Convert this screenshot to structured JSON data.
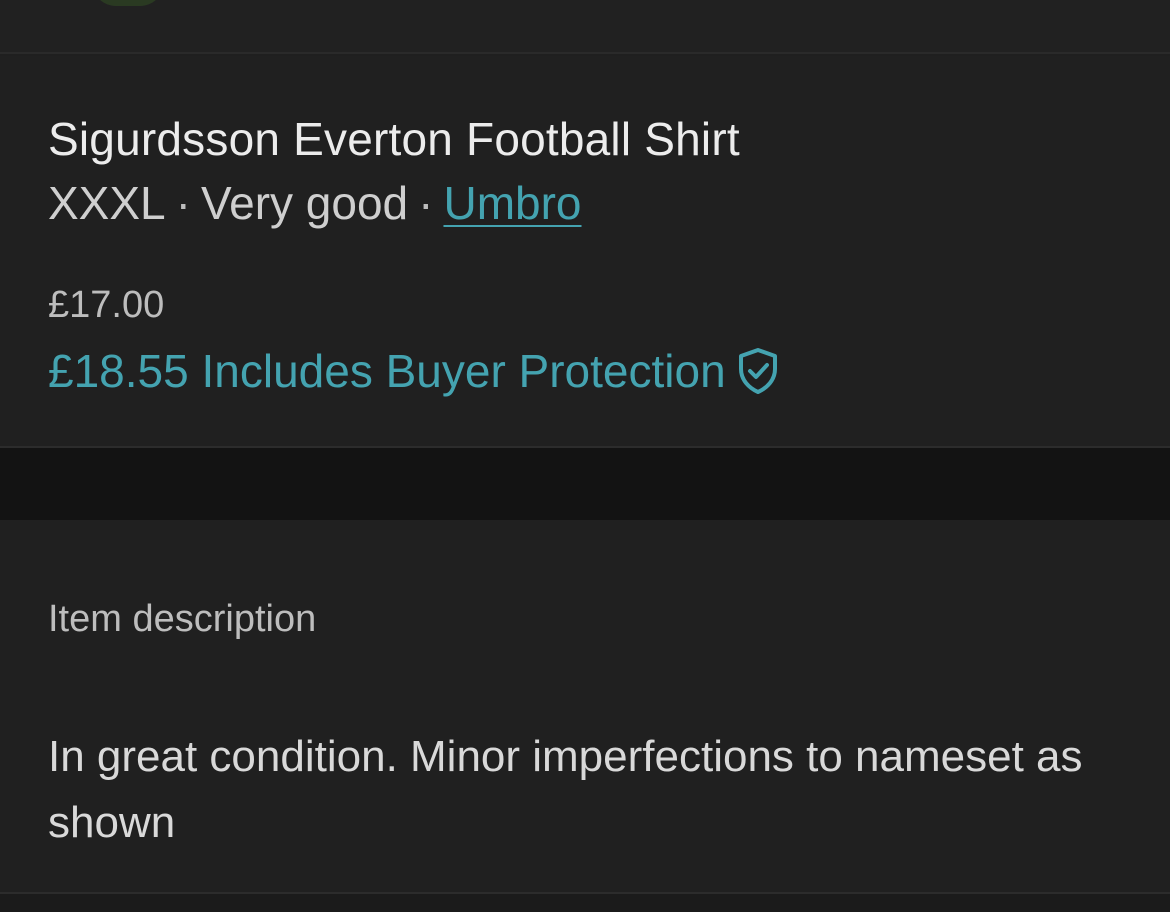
{
  "listing": {
    "title": "Sigurdsson Everton Football Shirt",
    "size": "XXXL",
    "separator": "·",
    "condition": "Very good",
    "brand": "Umbro",
    "price": "£17.00",
    "total_price": "£18.55",
    "protection_label": "Includes Buyer Protection",
    "protection_icon": "shield-check-icon"
  },
  "description": {
    "heading": "Item description",
    "text": "In great condition. Minor imperfections to nameset as shown"
  },
  "colors": {
    "background": "#1f1f1f",
    "accent": "#44a3b0",
    "text_primary": "#ececec",
    "text_secondary": "#bdbdbd"
  }
}
